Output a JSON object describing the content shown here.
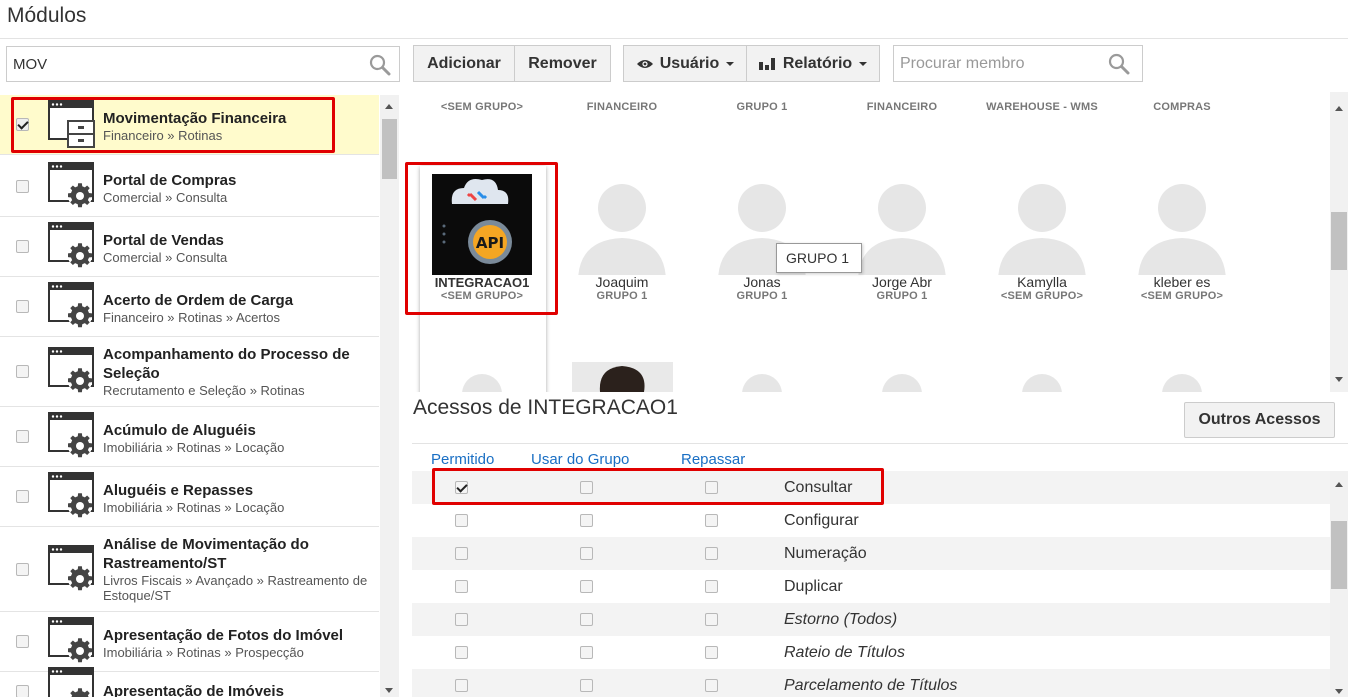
{
  "page": {
    "title": "Módulos"
  },
  "module_search": {
    "value": "MOV"
  },
  "modules": [
    {
      "name": "Movimentação Financeira",
      "path": "Financeiro » Rotinas",
      "checked": true,
      "icon": "drawer-window-icon"
    },
    {
      "name": "Portal de Compras",
      "path": "Comercial » Consulta",
      "checked": false,
      "icon": "gear-window-icon"
    },
    {
      "name": "Portal de Vendas",
      "path": "Comercial » Consulta",
      "checked": false,
      "icon": "gear-window-icon"
    },
    {
      "name": "Acerto de Ordem de Carga",
      "path": "Financeiro » Rotinas » Acertos",
      "checked": false,
      "icon": "gear-window-icon"
    },
    {
      "name": "Acompanhamento do Processo de Seleção",
      "path": "Recrutamento e Seleção » Rotinas",
      "checked": false,
      "icon": "gear-window-icon"
    },
    {
      "name": "Acúmulo de Aluguéis",
      "path": "Imobiliária » Rotinas » Locação",
      "checked": false,
      "icon": "gear-window-icon"
    },
    {
      "name": "Aluguéis e Repasses",
      "path": "Imobiliária » Rotinas » Locação",
      "checked": false,
      "icon": "gear-window-icon"
    },
    {
      "name": "Análise de Movimentação do Rastreamento/ST",
      "path": "Livros Fiscais » Avançado » Rastreamento de Estoque/ST",
      "checked": false,
      "icon": "gear-window-icon"
    },
    {
      "name": "Apresentação de Fotos do Imóvel",
      "path": "Imobiliária » Rotinas » Prospecção",
      "checked": false,
      "icon": "gear-window-icon"
    },
    {
      "name": "Apresentação de Imóveis",
      "path": "",
      "checked": false,
      "icon": "gear-window-icon"
    }
  ],
  "toolbar": {
    "add_label": "Adicionar",
    "remove_label": "Remover",
    "user_label": "Usuário",
    "report_label": "Relatório",
    "member_search_placeholder": "Procurar membro"
  },
  "members_top_groups": [
    "<SEM GRUPO>",
    "FINANCEIRO",
    "GRUPO 1",
    "FINANCEIRO",
    "WAREHOUSE - WMS",
    "COMPRAS"
  ],
  "members": [
    {
      "name": "INTEGRACAO1",
      "group": "<SEM GRUPO>",
      "avatar": "api-integration-image"
    },
    {
      "name": "Joaquim",
      "group": "GRUPO 1",
      "avatar": "default-person"
    },
    {
      "name": "Jonas",
      "group": "GRUPO 1",
      "avatar": "default-person"
    },
    {
      "name": "Jorge Abr",
      "group": "GRUPO 1",
      "avatar": "default-person"
    },
    {
      "name": "Kamylla",
      "group": "<SEM GRUPO>",
      "avatar": "default-person"
    },
    {
      "name": "kleber es",
      "group": "<SEM GRUPO>",
      "avatar": "default-person"
    }
  ],
  "api_badge": "API",
  "tooltip": "GRUPO 1",
  "access": {
    "title": "Acessos de INTEGRACAO1",
    "other_button": "Outros Acessos",
    "columns": [
      "Permitido",
      "Usar do Grupo",
      "Repassar"
    ],
    "rows": [
      {
        "label": "Consultar",
        "permitido": true,
        "usar_grupo": false,
        "repassar": false,
        "italic": false
      },
      {
        "label": "Configurar",
        "permitido": false,
        "usar_grupo": false,
        "repassar": false,
        "italic": false
      },
      {
        "label": "Numeração",
        "permitido": false,
        "usar_grupo": false,
        "repassar": false,
        "italic": false
      },
      {
        "label": "Duplicar",
        "permitido": false,
        "usar_grupo": false,
        "repassar": false,
        "italic": false
      },
      {
        "label": "Estorno (Todos)",
        "permitido": false,
        "usar_grupo": false,
        "repassar": false,
        "italic": true
      },
      {
        "label": "Rateio de Títulos",
        "permitido": false,
        "usar_grupo": false,
        "repassar": false,
        "italic": true
      },
      {
        "label": "Parcelamento de Títulos",
        "permitido": false,
        "usar_grupo": false,
        "repassar": false,
        "italic": true
      }
    ]
  },
  "colors": {
    "highlight": "#e00000",
    "link": "#1a6fc4",
    "selected_row": "#fffbcc"
  }
}
